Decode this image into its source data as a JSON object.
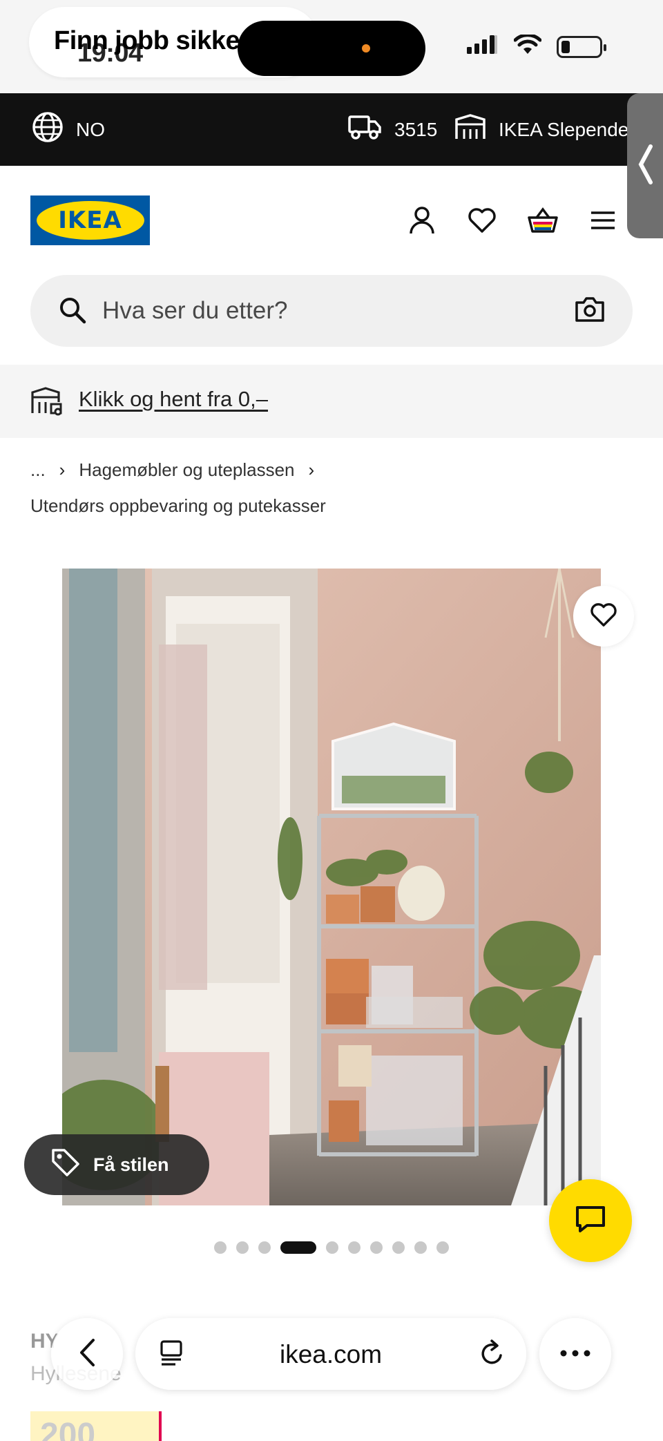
{
  "status_bar": {
    "time": "19:04",
    "overlay_text": "Finn jobb sikker"
  },
  "topbar": {
    "country": "NO",
    "postal_code": "3515",
    "store": "IKEA Slependen"
  },
  "header": {
    "logo_text": "IKEA"
  },
  "search": {
    "placeholder": "Hva ser du etter?"
  },
  "banner": {
    "link_text": "Klikk og hent fra 0,–"
  },
  "breadcrumb": {
    "ellipsis": "...",
    "level1": "Hagemøbler og uteplassen",
    "level2": "Utendørs oppbevaring og putekasser"
  },
  "product": {
    "style_button": "Få stilen",
    "title_partial": "HY",
    "subtitle_partial": "Hyllesene",
    "price_partial": "200"
  },
  "carousel": {
    "total": 10,
    "active_index": 3
  },
  "browser": {
    "url": "ikea.com"
  },
  "colors": {
    "ikea_blue": "#0058a3",
    "ikea_yellow": "#ffdb00",
    "topbar_bg": "#111111"
  }
}
